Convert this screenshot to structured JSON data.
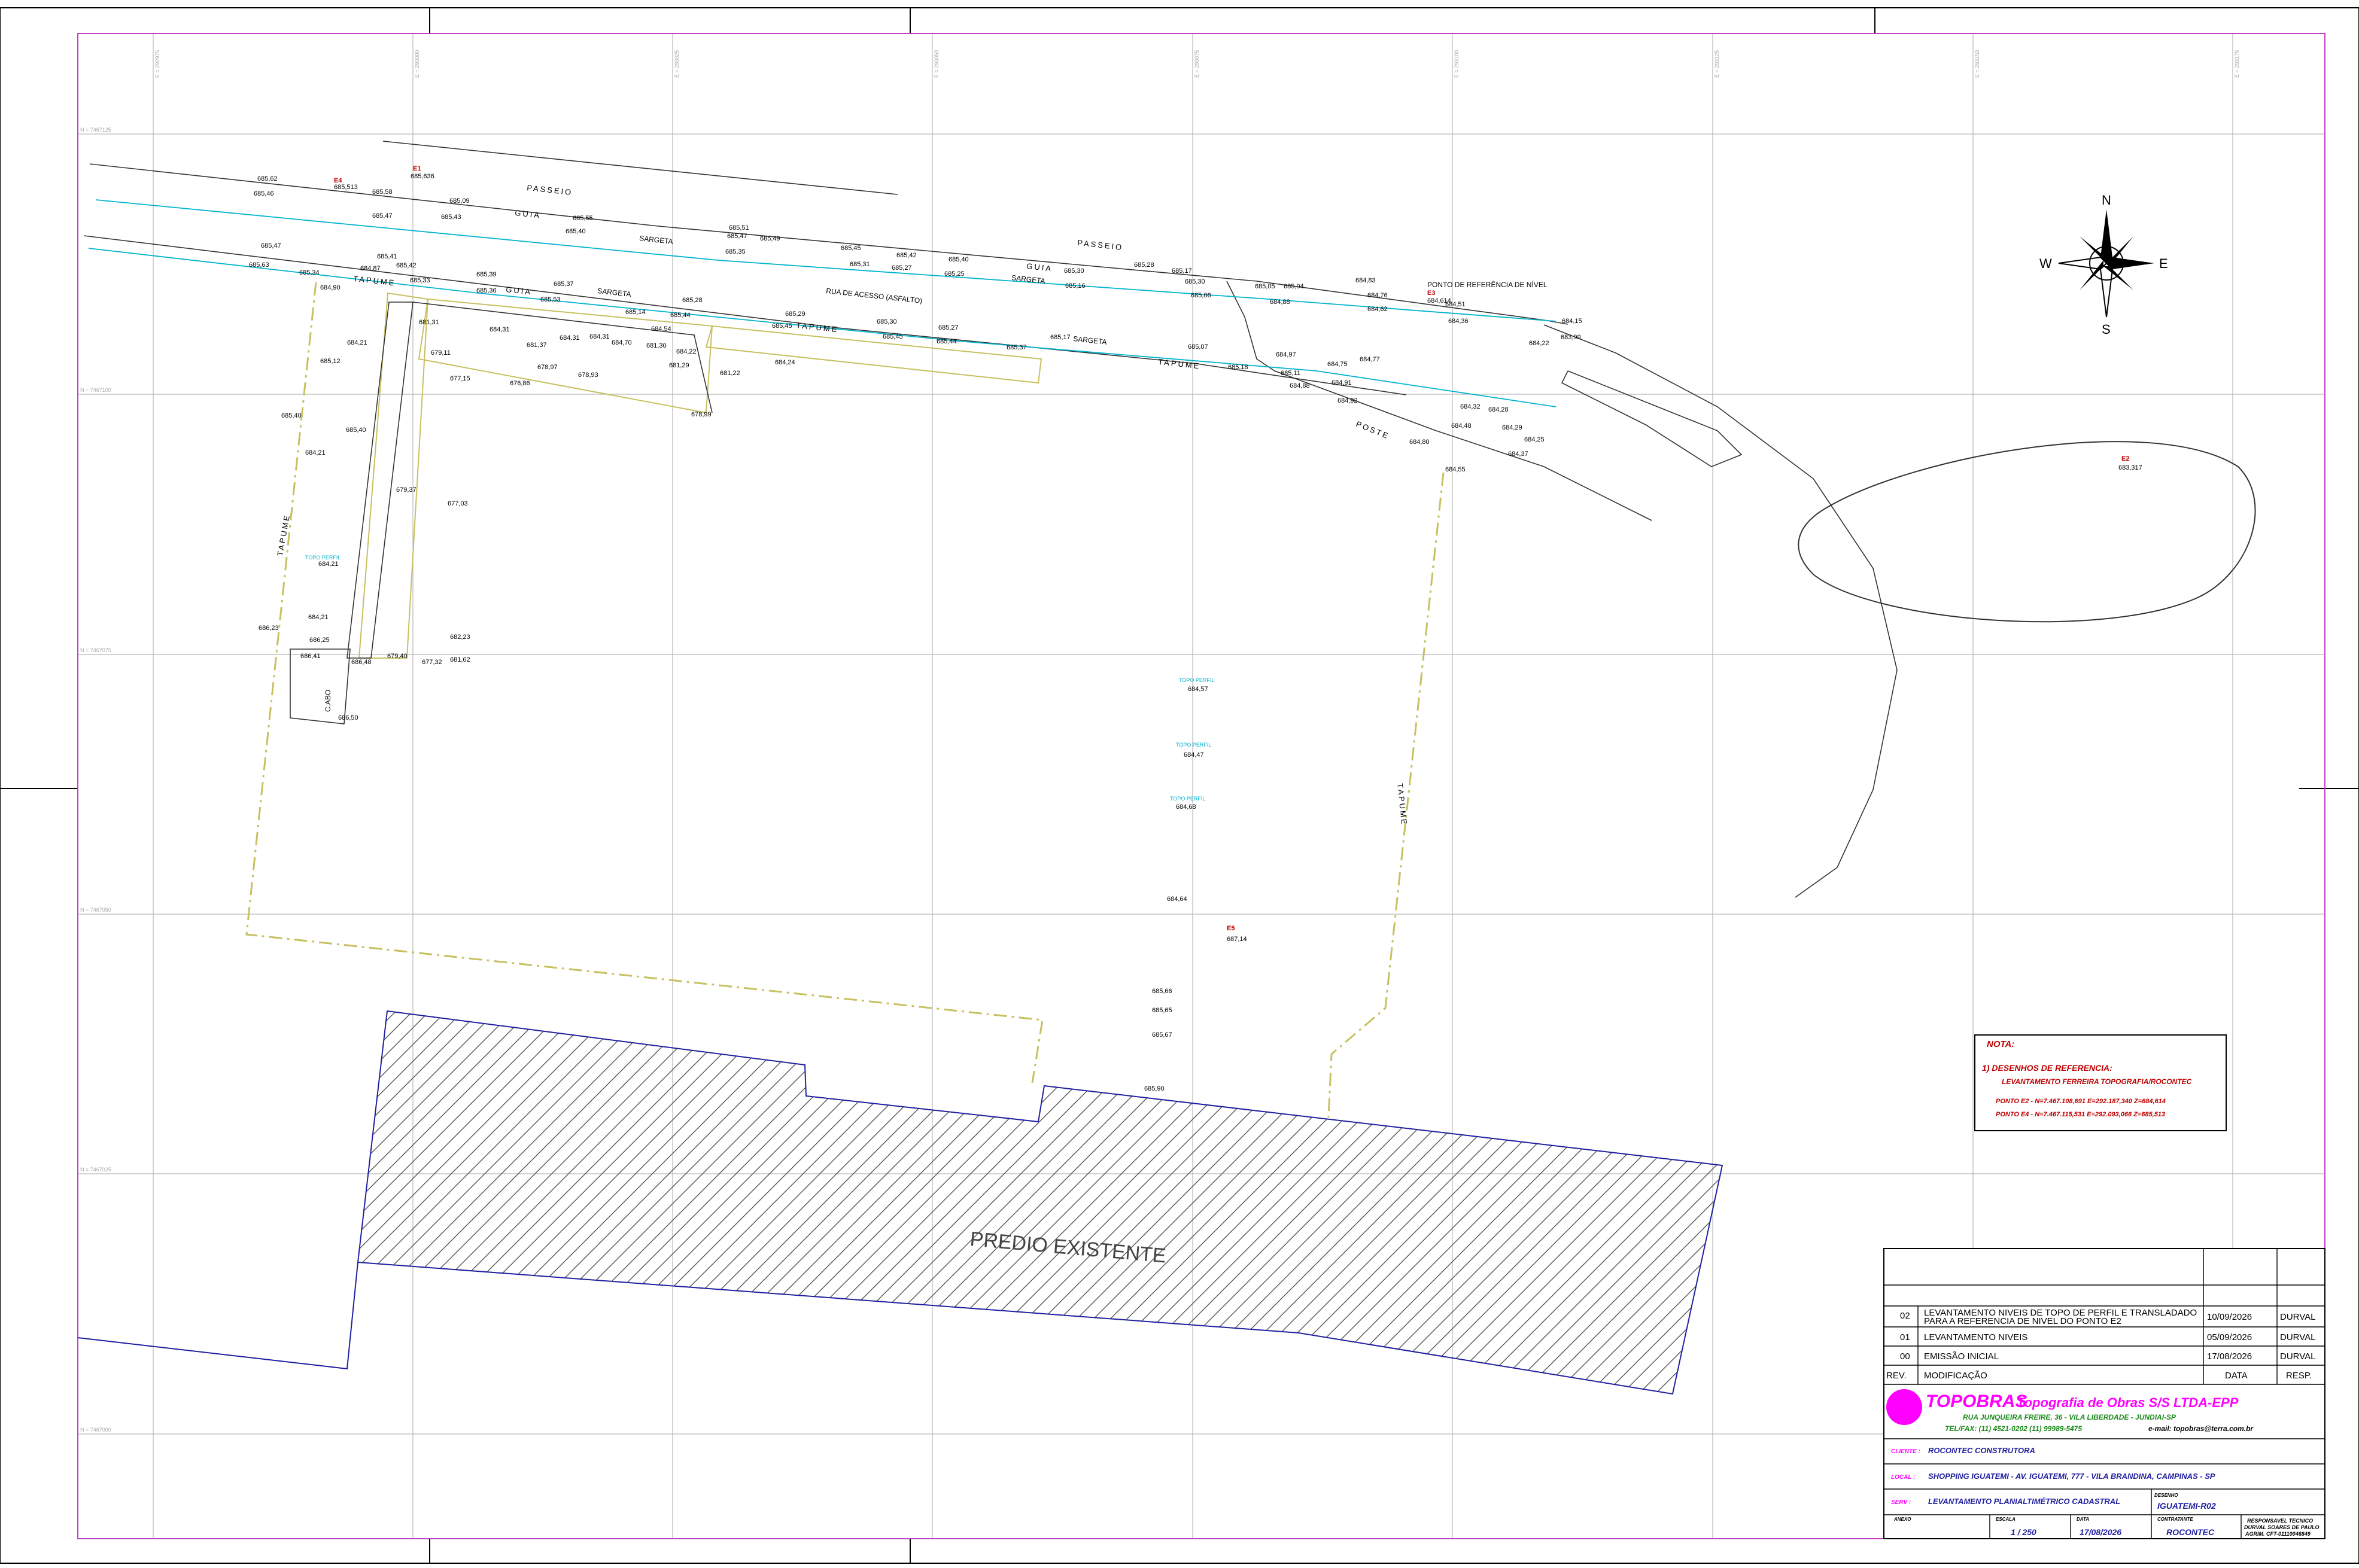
{
  "drawing": {
    "labels": {
      "passeio": "PASSEIO",
      "guia": "GUIA",
      "sargeta": "SARGETA",
      "tapume": "TAPUME",
      "rua": "RUA DE ACESSO (ASFALTO)",
      "ponto_ref": "PONTO DE REFERÊNCIA DE NÍVEL",
      "poste": "POSTE",
      "predio": "PREDIO EXISTENTE",
      "topo_perfil": "TOPO PERFIL",
      "cabo": "C.ABO"
    },
    "compass": {
      "n": "N",
      "s": "S",
      "e": "E",
      "w": "W"
    },
    "points": {
      "e1": "E1",
      "e2": "E2",
      "e3": "E3",
      "e4": "E4",
      "e5": "E5"
    },
    "elev": {
      "e1": "685,636",
      "e2": "683,317",
      "e3": "684,614",
      "e4": "685,513",
      "e5": "687,14",
      "v1": "685,62",
      "v2": "685,46",
      "v3": "685,58",
      "v4": "685,47",
      "v5": "685,09",
      "v6": "685,43",
      "v7": "685,55",
      "v8": "685,40",
      "v9": "685,51",
      "v10": "685,47",
      "v11": "685,49",
      "v12": "685,35",
      "v13": "685,45",
      "v14": "685,42",
      "v15": "685,31",
      "v16": "685,27",
      "v17": "685,40",
      "v18": "685,25",
      "v19": "685,30",
      "v20": "685,16",
      "v21": "685,28",
      "v22": "685,17",
      "v23": "685,30",
      "v24": "685,06",
      "v25": "685,05",
      "v26": "685,04",
      "v27": "684,88",
      "v28": "684,83",
      "v29": "684,76",
      "v30": "684,62",
      "v31": "684,51",
      "v32": "684,36",
      "v33": "684,22",
      "v34": "684,15",
      "v35": "683,99",
      "w1": "685,47",
      "w2": "685,63",
      "w3": "685,34",
      "w4": "685,41",
      "w5": "685,42",
      "w6": "684,90",
      "w7": "684,87",
      "w8": "685,33",
      "w9": "685,39",
      "w10": "685,36",
      "w11": "685,37",
      "w12": "685,53",
      "w13": "685,28",
      "w14": "685,14",
      "w15": "685,44",
      "w16": "685,29",
      "w17": "685,45",
      "w18": "685,30",
      "w19": "685,45",
      "w20": "685,27",
      "w21": "685,44",
      "w22": "685,17",
      "w23": "685,37",
      "w24": "685,07",
      "w25": "684,97",
      "w26": "685,18",
      "w27": "685,11",
      "w28": "684,75",
      "w29": "684,77",
      "w30": "684,88",
      "w31": "684,91",
      "w32": "684,92",
      "w33": "684,80",
      "w34": "684,55",
      "w35": "684,32",
      "w36": "684,28",
      "w37": "684,48",
      "w38": "684,29",
      "w39": "684,25",
      "w40": "684,37",
      "s1": "684,31",
      "s2": "684,21",
      "s3": "684,31",
      "s4": "681,31",
      "s5": "684,31",
      "s6": "684,70",
      "s7": "684,54",
      "s8": "681,30",
      "s9": "684,22",
      "s10": "681,29",
      "s11": "681,22",
      "s12": "684,24",
      "s13": "678,99",
      "s14": "679,11",
      "s15": "677,15",
      "s16": "676,86",
      "s17": "678,97",
      "s18": "678,93",
      "s19": "681,37",
      "s20": "685,12",
      "s21": "685,40",
      "s22": "684,21",
      "s23": "685,40",
      "s24": "679,37",
      "s25": "677,03",
      "s26": "684,21",
      "s27": "684,21",
      "s28": "686,23",
      "s29": "686,25",
      "s30": "686,41",
      "s31": "686,48",
      "s32": "679,40",
      "s33": "677,32",
      "s34": "682,23",
      "s35": "681,62",
      "s36": "686,50",
      "c1": "684,57",
      "c2": "684,47",
      "c3": "684,68",
      "c4": "684,64",
      "c5": "685,66",
      "c6": "685,65",
      "c7": "685,67",
      "c8": "685,90"
    },
    "grid": {
      "n1": "N = 7467125",
      "n2": "N = 7467100",
      "n3": "N = 7467075",
      "n4": "N = 7467050",
      "n5": "N = 7467025",
      "n6": "N = 7467000",
      "e1": "E = 292975",
      "e2": "E = 293000",
      "e3": "E = 293025",
      "e4": "E = 293050",
      "e5": "E = 293075",
      "e6": "E = 293100",
      "e7": "E = 293125",
      "e8": "E = 293150",
      "e9": "E = 293175"
    }
  },
  "nota": {
    "title": "NOTA:",
    "item": "1)  DESENHOS DE REFERENCIA:",
    "ref": "LEVANTAMENTO FERREIRA TOPOGRAFIA/ROCONTEC",
    "e2": "PONTO E2  -  N=7.467.108,691   E=292.187,340   Z=684,614",
    "e4": "PONTO E4  -  N=7.467.115,531   E=292.093,066   Z=685,513"
  },
  "titleblock": {
    "revisions": [
      {
        "rev": "02",
        "line1": "LEVANTAMENTO NIVEIS DE TOPO DE PERFIL E TRANSLADADO",
        "line2": "PARA A REFERENCIA DE NIVEL DO PONTO E2",
        "date": "10/09/2026",
        "resp": "DURVAL"
      },
      {
        "rev": "01",
        "line1": "LEVANTAMENTO NIVEIS",
        "line2": "",
        "date": "05/09/2026",
        "resp": "DURVAL"
      },
      {
        "rev": "00",
        "line1": "EMISSÃO INICIAL",
        "line2": "",
        "date": "17/08/2026",
        "resp": "DURVAL"
      }
    ],
    "header": {
      "rev": "REV.",
      "mod": "MODIFICAÇÃO",
      "date": "DATA",
      "resp": "RESP."
    },
    "company": "TOPOBRAS",
    "company_sub": "Topografia de Obras S/S LTDA-EPP",
    "address": "RUA JUNQUEIRA FREIRE, 36  -  VILA LIBERDADE  -  JUNDIAI-SP",
    "phone": "TEL/FAX: (11) 4521-0202 (11) 99989-5475",
    "email": "e-mail: topobras@terra.com.br",
    "cliente_label": "CLIENTE :",
    "cliente": "ROCONTEC CONSTRUTORA",
    "local_label": "LOCAL :",
    "local": "SHOPPING IGUATEMI  -  AV. IGUATEMI, 777  -  VILA BRANDINA, CAMPINAS  -  SP",
    "serv_label": "SERV :",
    "serv": "LEVANTAMENTO PLANIALTIMÉTRICO CADASTRAL",
    "desenho_label": "DESENHO",
    "desenho": "IGUATEMI-R02",
    "anexo_label": "ANEXO",
    "escala_label": "ESCALA",
    "escala": "1  /  250",
    "data_label": "DATA",
    "data": "17/08/2026",
    "obra_label": "CONTRATANTE",
    "obra": "ROCONTEC",
    "resp_label": "RESPONSAVEL TECNICO",
    "resp_name": "DURVAL SOARES DE PAULO",
    "resp_crea": "AGRIM. CFT-01110046849"
  },
  "colors": {
    "frame": "#c040c0",
    "cyan": "#00b4cf",
    "red": "#c00000",
    "yellow": "#c8c060",
    "blue": "#2020a0",
    "magenta": "#ff00ff"
  }
}
